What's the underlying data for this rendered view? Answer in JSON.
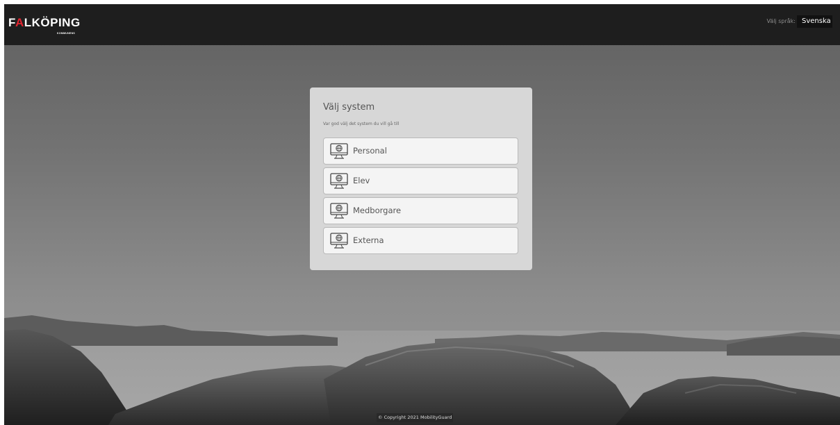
{
  "header": {
    "logo_prefix": "F",
    "logo_accent": "A",
    "logo_rest": "LKÖPING",
    "logo_sub": "KOMMUNENS",
    "language_label": "Välj språk:",
    "language_selected": "Svenska"
  },
  "card": {
    "title": "Välj system",
    "subtitle": "Var god välj det system du vill gå till",
    "options": [
      {
        "label": "Personal",
        "icon": "monitor-globe-icon"
      },
      {
        "label": "Elev",
        "icon": "monitor-globe-icon"
      },
      {
        "label": "Medborgare",
        "icon": "monitor-globe-icon"
      },
      {
        "label": "Externa",
        "icon": "monitor-globe-icon"
      }
    ]
  },
  "footer": {
    "copyright": "© Copyright 2021 MobilityGuard"
  },
  "colors": {
    "header_bg": "#1e1e1e",
    "logo_accent": "#e2242f",
    "card_bg": "#d7d7d7",
    "button_bg": "#f4f4f4"
  }
}
